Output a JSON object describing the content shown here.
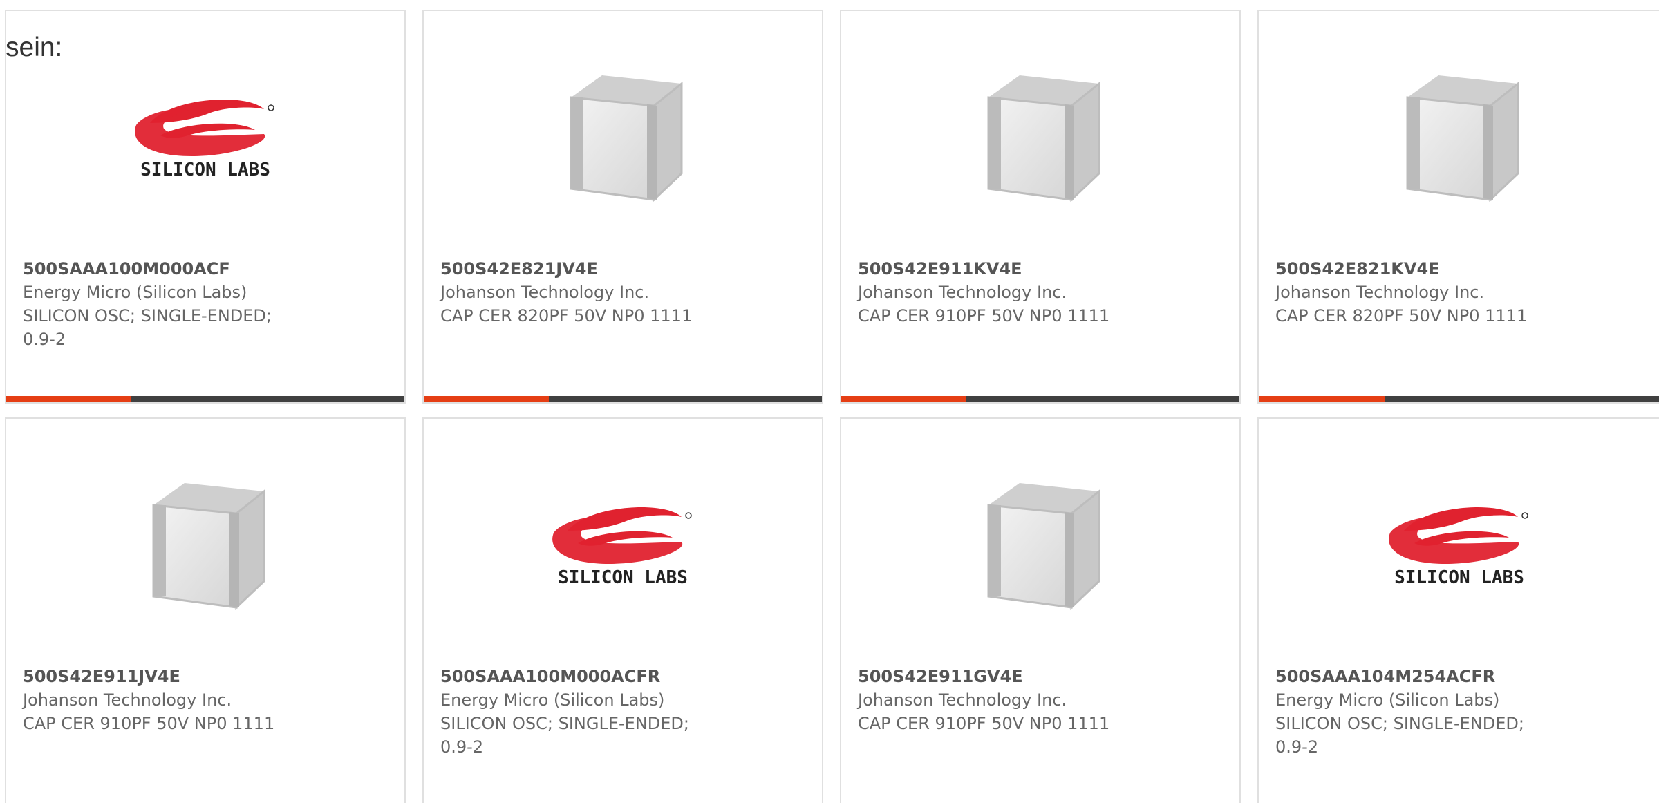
{
  "intro_text": "sein:",
  "colors": {
    "accent": "#e53e14",
    "bar": "#404040",
    "logo_red": "#e0222f"
  },
  "products": [
    {
      "part": "500SAAA100M000ACF",
      "manufacturer": "Energy Micro (Silicon Labs)",
      "desc1": "SILICON OSC; SINGLE-ENDED;",
      "desc2": "0.9-2",
      "image": "silicon-labs-logo",
      "logo_text": "SILICON LABS"
    },
    {
      "part": "500S42E821JV4E",
      "manufacturer": "Johanson Technology Inc.",
      "desc1": "CAP CER 820PF 50V NP0 1111",
      "desc2": "",
      "image": "capacitor-cube"
    },
    {
      "part": "500S42E911KV4E",
      "manufacturer": "Johanson Technology Inc.",
      "desc1": "CAP CER 910PF 50V NP0 1111",
      "desc2": "",
      "image": "capacitor-cube"
    },
    {
      "part": "500S42E821KV4E",
      "manufacturer": "Johanson Technology Inc.",
      "desc1": "CAP CER 820PF 50V NP0 1111",
      "desc2": "",
      "image": "capacitor-cube"
    },
    {
      "part": "500S42E911JV4E",
      "manufacturer": "Johanson Technology Inc.",
      "desc1": "CAP CER 910PF 50V NP0 1111",
      "desc2": "",
      "image": "capacitor-cube"
    },
    {
      "part": "500SAAA100M000ACFR",
      "manufacturer": "Energy Micro (Silicon Labs)",
      "desc1": "SILICON OSC; SINGLE-ENDED;",
      "desc2": "0.9-2",
      "image": "silicon-labs-logo",
      "logo_text": "SILICON LABS"
    },
    {
      "part": "500S42E911GV4E",
      "manufacturer": "Johanson Technology Inc.",
      "desc1": "CAP CER 910PF 50V NP0 1111",
      "desc2": "",
      "image": "capacitor-cube"
    },
    {
      "part": "500SAAA104M254ACFR",
      "manufacturer": "Energy Micro (Silicon Labs)",
      "desc1": "SILICON OSC; SINGLE-ENDED;",
      "desc2": "0.9-2",
      "image": "silicon-labs-logo",
      "logo_text": "SILICON LABS"
    }
  ]
}
